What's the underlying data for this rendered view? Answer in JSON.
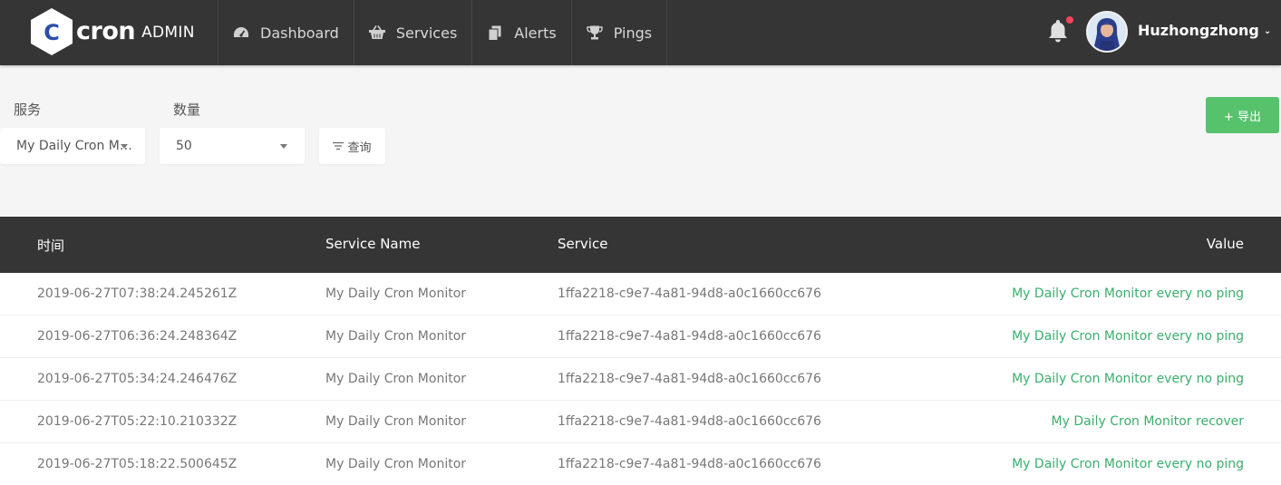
{
  "brand": {
    "logo_letter": "C",
    "name": "cron",
    "suffix": "ADMIN"
  },
  "nav": [
    {
      "label": "Dashboard",
      "icon": "gauge-icon"
    },
    {
      "label": "Services",
      "icon": "basket-icon"
    },
    {
      "label": "Alerts",
      "icon": "files-icon"
    },
    {
      "label": "Pings",
      "icon": "trophy-icon"
    }
  ],
  "user": {
    "name": "Huzhongzhong",
    "has_notification": true
  },
  "filters": {
    "service_label": "服务",
    "service_value": "My Daily Cron Monitor",
    "count_label": "数量",
    "count_value": "50",
    "query_label": "查询",
    "export_label": "+ 导出"
  },
  "table": {
    "headers": {
      "time": "时间",
      "service_name": "Service Name",
      "service": "Service",
      "value": "Value"
    },
    "rows": [
      {
        "time": "2019-06-27T07:38:24.245261Z",
        "service_name": "My Daily Cron Monitor",
        "service": "1ffa2218-c9e7-4a81-94d8-a0c1660cc676",
        "value": "My Daily Cron Monitor every no ping"
      },
      {
        "time": "2019-06-27T06:36:24.248364Z",
        "service_name": "My Daily Cron Monitor",
        "service": "1ffa2218-c9e7-4a81-94d8-a0c1660cc676",
        "value": "My Daily Cron Monitor every no ping"
      },
      {
        "time": "2019-06-27T05:34:24.246476Z",
        "service_name": "My Daily Cron Monitor",
        "service": "1ffa2218-c9e7-4a81-94d8-a0c1660cc676",
        "value": "My Daily Cron Monitor every no ping"
      },
      {
        "time": "2019-06-27T05:22:10.210332Z",
        "service_name": "My Daily Cron Monitor",
        "service": "1ffa2218-c9e7-4a81-94d8-a0c1660cc676",
        "value": "My Daily Cron Monitor recover"
      },
      {
        "time": "2019-06-27T05:18:22.500645Z",
        "service_name": "My Daily Cron Monitor",
        "service": "1ffa2218-c9e7-4a81-94d8-a0c1660cc676",
        "value": "My Daily Cron Monitor every no ping"
      }
    ]
  },
  "colors": {
    "topbar": "#353535",
    "accent_green": "#56c26c",
    "value_green": "#3bae6e",
    "notification_red": "#f2455a",
    "logo_blue": "#2a4ea8"
  }
}
